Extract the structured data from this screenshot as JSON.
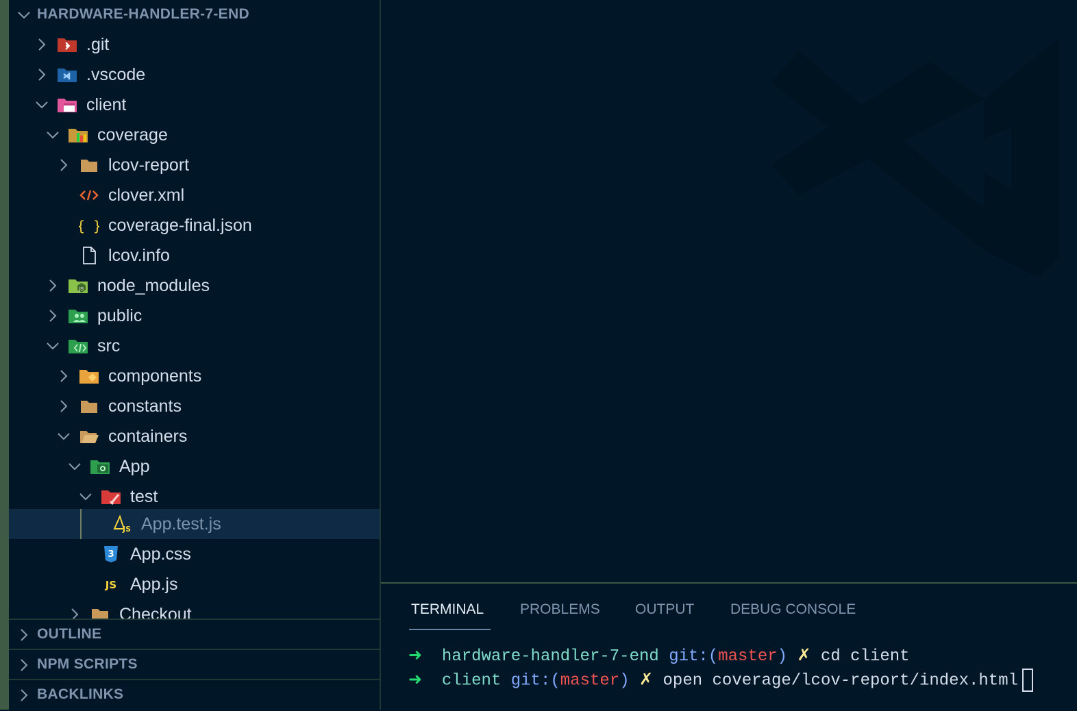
{
  "explorer": {
    "root_label": "HARDWARE-HANDLER-7-END",
    "items": [
      {
        "label": ".git",
        "icon": "folder-git-icon",
        "expanded": false,
        "depth": 1
      },
      {
        "label": ".vscode",
        "icon": "folder-vscode-icon",
        "expanded": false,
        "depth": 1
      },
      {
        "label": "client",
        "icon": "folder-client-icon",
        "expanded": true,
        "depth": 1
      },
      {
        "label": "coverage",
        "icon": "folder-coverage-icon",
        "expanded": true,
        "depth": 2
      },
      {
        "label": "lcov-report",
        "icon": "folder-icon",
        "expanded": false,
        "depth": 3
      },
      {
        "label": "clover.xml",
        "icon": "xml-file-icon",
        "depth": 3
      },
      {
        "label": "coverage-final.json",
        "icon": "json-file-icon",
        "depth": 3
      },
      {
        "label": "lcov.info",
        "icon": "file-icon",
        "depth": 3
      },
      {
        "label": "node_modules",
        "icon": "folder-node-icon",
        "expanded": false,
        "depth": 2
      },
      {
        "label": "public",
        "icon": "folder-public-icon",
        "expanded": false,
        "depth": 2
      },
      {
        "label": "src",
        "icon": "folder-src-icon",
        "expanded": true,
        "depth": 2
      },
      {
        "label": "components",
        "icon": "folder-components-icon",
        "expanded": false,
        "depth": 3
      },
      {
        "label": "constants",
        "icon": "folder-icon",
        "expanded": false,
        "depth": 3
      },
      {
        "label": "containers",
        "icon": "folder-open-icon",
        "expanded": true,
        "depth": 3
      },
      {
        "label": "App",
        "icon": "folder-app-icon",
        "expanded": true,
        "depth": 4
      },
      {
        "label": "test",
        "icon": "folder-test-icon",
        "expanded": true,
        "depth": 5
      },
      {
        "label": "App.test.js",
        "icon": "test-js-file-icon",
        "depth": 6,
        "selected": true
      },
      {
        "label": "App.css",
        "icon": "css-file-icon",
        "depth": 5
      },
      {
        "label": "App.js",
        "icon": "js-file-icon",
        "depth": 5
      },
      {
        "label": "Checkout",
        "icon": "folder-icon",
        "expanded": false,
        "depth": 4
      }
    ]
  },
  "sections": {
    "outline": "OUTLINE",
    "npm_scripts": "NPM SCRIPTS",
    "backlinks": "BACKLINKS"
  },
  "panel": {
    "tabs": [
      "TERMINAL",
      "PROBLEMS",
      "OUTPUT",
      "DEBUG CONSOLE"
    ],
    "active_tab": "TERMINAL"
  },
  "terminal": {
    "lines": [
      {
        "arrow": "➜",
        "dir": "hardware-handler-7-end",
        "git": "git:(",
        "branch": "master",
        "git_close": ")",
        "dirty": "✗",
        "command": "cd client"
      },
      {
        "arrow": "➜",
        "dir": "client",
        "git": "git:(",
        "branch": "master",
        "git_close": ")",
        "dirty": "✗",
        "command": "open coverage/lcov-report/index.html"
      }
    ]
  },
  "colors": {
    "background": "#011627",
    "selection": "#0e2a45",
    "prompt_arrow": "#22da6e",
    "branch": "#ef5350",
    "git": "#82aaff"
  }
}
